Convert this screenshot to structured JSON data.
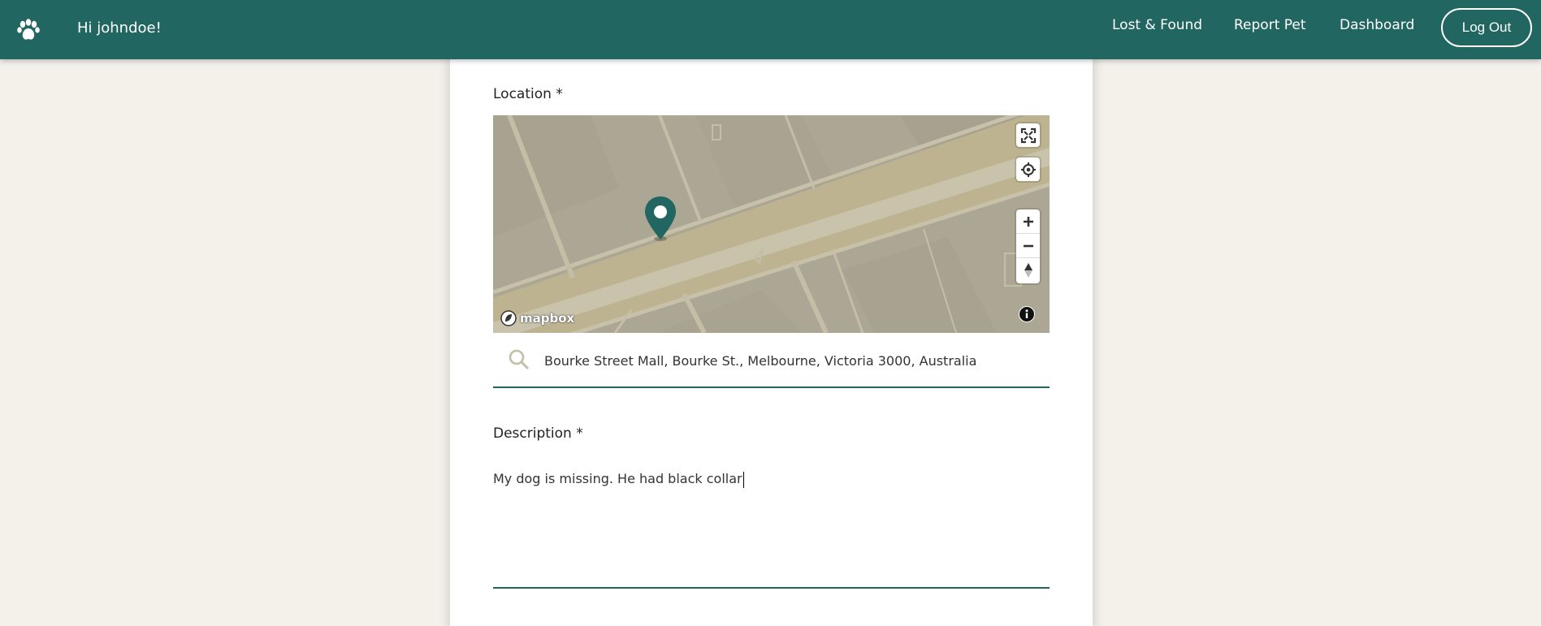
{
  "header": {
    "greeting": "Hi johndoe!",
    "nav": {
      "lost_found": "Lost & Found",
      "report_pet": "Report Pet",
      "dashboard": "Dashboard",
      "logout": "Log Out"
    },
    "logo_icon": "paw-icon",
    "bg_color": "#216660"
  },
  "form": {
    "location_label": "Location *",
    "location_value": "Bourke Street Mall, Bourke St., Melbourne, Victoria 3000, Australia",
    "description_label": "Description *",
    "description_value": "My dog is missing. He had black collar"
  },
  "map": {
    "attribution_logo": "mapbox",
    "controls": [
      "fullscreen-icon",
      "geolocate-icon",
      "zoom-in-icon",
      "zoom-out-icon",
      "compass-icon",
      "info-icon"
    ],
    "marker_color": "#216660"
  }
}
